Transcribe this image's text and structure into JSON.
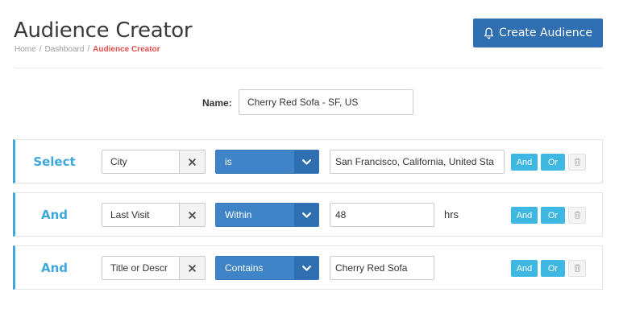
{
  "header": {
    "title": "Audience Creator",
    "breadcrumb": [
      "Home",
      "Dashboard",
      "Audience Creator"
    ],
    "separator": "/",
    "create_button_label": "Create Audience",
    "create_button_icon": "bell-icon"
  },
  "name_field": {
    "label": "Name:",
    "value": "Cherry Red Sofa - SF, US"
  },
  "rules": [
    {
      "connector": "Select",
      "field": "City",
      "operator": "is",
      "value": "San Francisco, California, United Sta",
      "unit": "",
      "and_label": "And",
      "or_label": "Or"
    },
    {
      "connector": "And",
      "field": "Last Visit",
      "operator": "Within",
      "value": "48",
      "unit": "hrs",
      "and_label": "And",
      "or_label": "Or"
    },
    {
      "connector": "And",
      "field": "Title or Descr",
      "operator": "Contains",
      "value": "Cherry Red Sofa",
      "unit": "",
      "and_label": "And",
      "or_label": "Or"
    }
  ],
  "colors": {
    "accent": "#3ea8dc",
    "primary": "#2f6fb1",
    "select_blue": "#3e84c7",
    "button_cyan": "#3fb7e3",
    "breadcrumb_active": "#e2504f"
  }
}
